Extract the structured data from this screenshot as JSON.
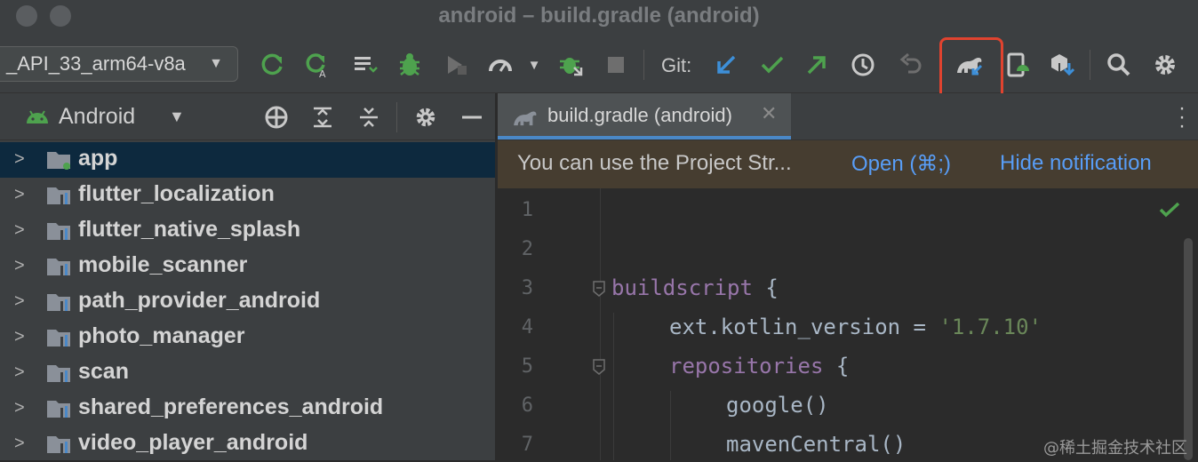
{
  "window": {
    "title": "android – build.gradle (android)"
  },
  "toolbar": {
    "device_selector": "_API_33_arm64-v8a",
    "git_label": "Git:",
    "icons": [
      "refresh-icon",
      "apply-code-changes-icon",
      "logcat-icon",
      "debug-icon",
      "profiler-icon",
      "run-coverage-icon",
      "more-icon",
      "attach-debugger-icon",
      "stop-icon",
      "git-update-icon",
      "git-commit-icon",
      "git-push-icon",
      "history-icon",
      "rollback-icon",
      "gradle-sync-icon",
      "device-manager-icon",
      "sdk-manager-icon",
      "search-icon",
      "settings-icon"
    ]
  },
  "project_panel": {
    "title": "Android",
    "items": [
      {
        "label": "app",
        "selected": true
      },
      {
        "label": "flutter_localization"
      },
      {
        "label": "flutter_native_splash"
      },
      {
        "label": "mobile_scanner"
      },
      {
        "label": "path_provider_android"
      },
      {
        "label": "photo_manager"
      },
      {
        "label": "scan"
      },
      {
        "label": "shared_preferences_android"
      },
      {
        "label": "video_player_android"
      }
    ]
  },
  "editor": {
    "tab_label": "build.gradle (android)",
    "notification": {
      "text": "You can use the Project Str...",
      "open_label": "Open (⌘;)",
      "hide_label": "Hide notification"
    },
    "line_numbers": [
      "1",
      "2",
      "3",
      "4",
      "5",
      "6",
      "7"
    ],
    "code": {
      "l3_kw": "buildscript",
      "l3_rest": " {",
      "l4_a": "ext.kotlin_version = ",
      "l4_str": "'1.7.10'",
      "l5_kw": "repositories",
      "l5_rest": " {",
      "l6": "google()",
      "l7": "mavenCentral()"
    }
  },
  "watermark": "@稀土掘金技术社区",
  "colors": {
    "accent": "#4a88c7",
    "highlight_box": "#e0432f",
    "green_icons": "#4ea24e",
    "link": "#589df6"
  }
}
